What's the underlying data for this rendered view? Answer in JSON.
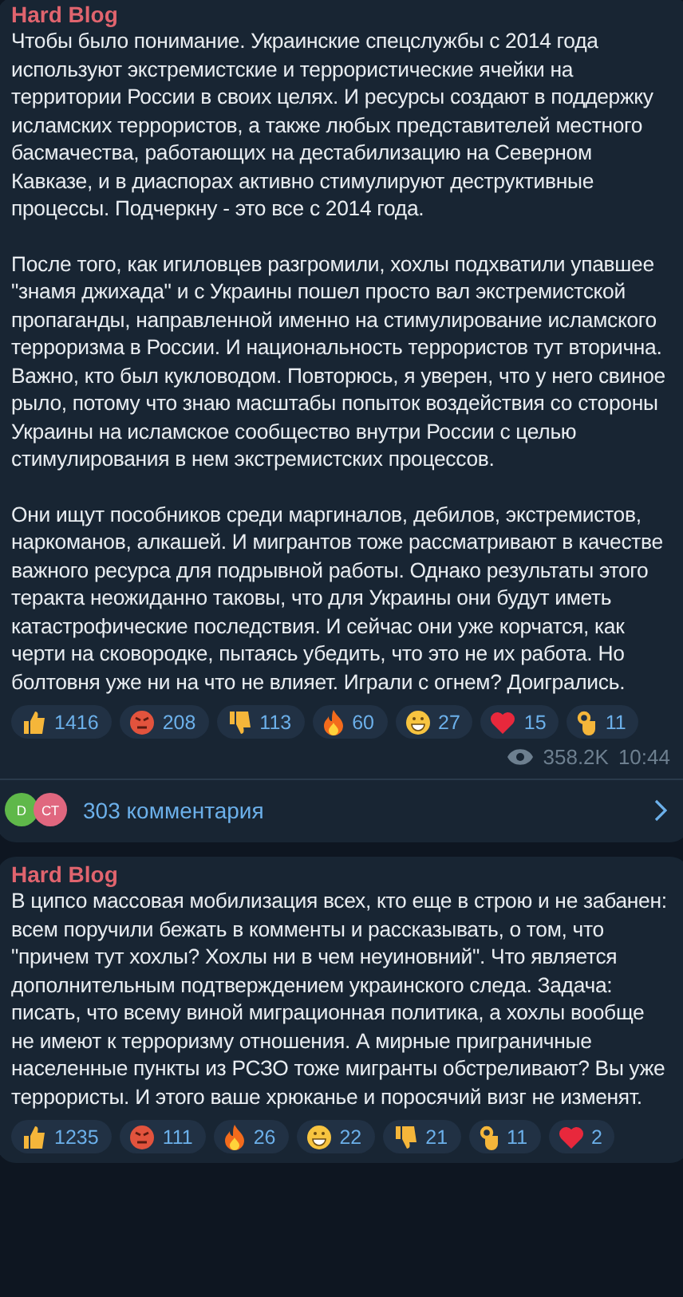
{
  "posts": [
    {
      "channel": "Hard Blog",
      "paragraphs": [
        "Чтобы было понимание. Украинские спецслужбы с 2014 года используют экстремистские и террористические ячейки на территории России в своих целях. И ресурсы создают в поддержку исламских террористов, а также любых представителей местного басмачества, работающих на дестабилизацию на Северном Кавказе, и в диаспорах активно стимулируют деструктивные процессы. Подчеркну - это все с 2014 года.",
        "После того, как игиловцев разгромили, хохлы подхватили упавшее \"знамя джихада\" и с Украины пошел просто вал экстремистской пропаганды, направленной именно на стимулирование исламского терроризма в России. И национальность террористов тут вторична. Важно, кто был кукловодом. Повторюсь, я уверен, что у него свиное рыло, потому что знаю масштабы попыток воздействия со стороны Украины на исламское сообщество внутри России с целью стимулирования в нем экстремистских процессов.",
        "Они ищут пособников среди маргиналов, дебилов, экстремистов, наркоманов, алкашей. И мигрантов тоже рассматривают в качестве важного ресурса для подрывной работы. Однако результаты этого теракта неожиданно таковы, что для Украины они будут иметь катастрофические последствия. И сейчас они уже корчатся, как черти на сковородке, пытаясь убедить, что это не их работа. Но болтовня уже ни на что не влияет. Играли с огнем? Доигрались."
      ],
      "reactions": [
        {
          "kind": "thumbsup",
          "count": "1416"
        },
        {
          "kind": "angry",
          "count": "208"
        },
        {
          "kind": "thumbsdown",
          "count": "113"
        },
        {
          "kind": "fire",
          "count": "60"
        },
        {
          "kind": "grin",
          "count": "27"
        },
        {
          "kind": "heart",
          "count": "15"
        },
        {
          "kind": "ok",
          "count": "11"
        }
      ],
      "views": "358.2K",
      "time": "10:44",
      "comments": {
        "avatars": [
          {
            "initials": "D",
            "color": "#5fb84a"
          },
          {
            "initials": "СТ",
            "color": "#e0677f"
          }
        ],
        "label": "303 комментария"
      }
    },
    {
      "channel": "Hard Blog",
      "paragraphs": [
        "В ципсо массовая мобилизация всех, кто еще в строю и не забанен: всем поручили бежать в комменты и рассказывать, о том, что \"причем тут хохлы? Хохлы ни в чем неуиновний\". Что является дополнительным подтверждением украинского следа. Задача: писать, что всему виной миграционная политика, а хохлы вообще не имеют к терроризму отношения. А мирные приграничные населенные пункты из РСЗО тоже мигранты обстреливают? Вы уже террористы. И этого ваше хрюканье и поросячий визг не изменят."
      ],
      "reactions": [
        {
          "kind": "thumbsup",
          "count": "1235"
        },
        {
          "kind": "angry",
          "count": "111"
        },
        {
          "kind": "fire",
          "count": "26"
        },
        {
          "kind": "grin",
          "count": "22"
        },
        {
          "kind": "thumbsdown",
          "count": "21"
        },
        {
          "kind": "ok",
          "count": "11"
        },
        {
          "kind": "heart",
          "count": "2"
        }
      ]
    }
  ]
}
